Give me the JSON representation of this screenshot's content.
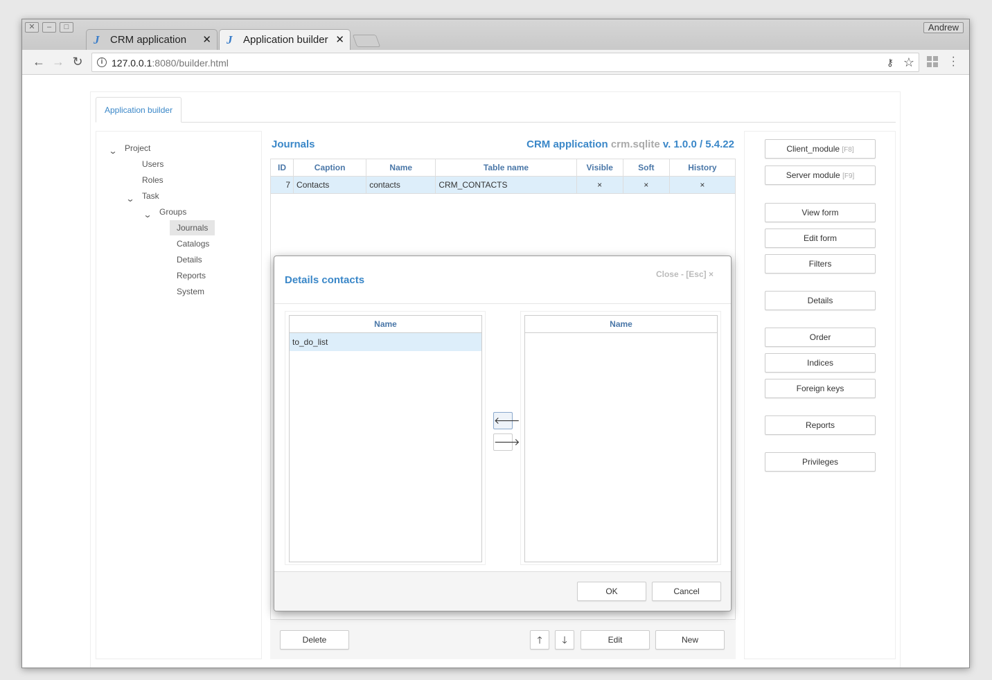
{
  "browser": {
    "user": "Andrew",
    "tabs": [
      {
        "label": "CRM application"
      },
      {
        "label": "Application builder"
      }
    ],
    "url_host": "127.0.0.1",
    "url_rest": ":8080/builder.html"
  },
  "app": {
    "tab_label": "Application builder",
    "tree": {
      "project": "Project",
      "users": "Users",
      "roles": "Roles",
      "task": "Task",
      "groups": "Groups",
      "journals": "Journals",
      "catalogs": "Catalogs",
      "details": "Details",
      "reports": "Reports",
      "system": "System"
    },
    "center": {
      "title": "Journals",
      "app_name": "CRM application",
      "db": "crm.sqlite",
      "version": "v. 1.0.0 / 5.4.22",
      "columns": [
        "ID",
        "Caption",
        "Name",
        "Table name",
        "Visible",
        "Soft",
        "History"
      ],
      "row": {
        "id": "7",
        "caption": "Contacts",
        "name": "contacts",
        "table_name": "CRM_CONTACTS",
        "visible": "×",
        "soft": "×",
        "history": "×"
      },
      "buttons": {
        "delete": "Delete",
        "edit": "Edit",
        "new": "New"
      }
    },
    "right_buttons": {
      "client_module": "Client_module",
      "client_hotkey": "[F8]",
      "server_module": "Server module",
      "server_hotkey": "[F9]",
      "view_form": "View form",
      "edit_form": "Edit form",
      "filters": "Filters",
      "details": "Details",
      "order": "Order",
      "indices": "Indices",
      "foreign_keys": "Foreign keys",
      "reports": "Reports",
      "privileges": "Privileges"
    },
    "modal": {
      "title": "Details  contacts",
      "close": "Close - [Esc] ×",
      "left_header": "Name",
      "left_items": [
        "to_do_list"
      ],
      "right_header": "Name",
      "ok": "OK",
      "cancel": "Cancel"
    }
  },
  "colors": {
    "accent": "#3a87c8",
    "selected_row": "#ddeefa"
  }
}
